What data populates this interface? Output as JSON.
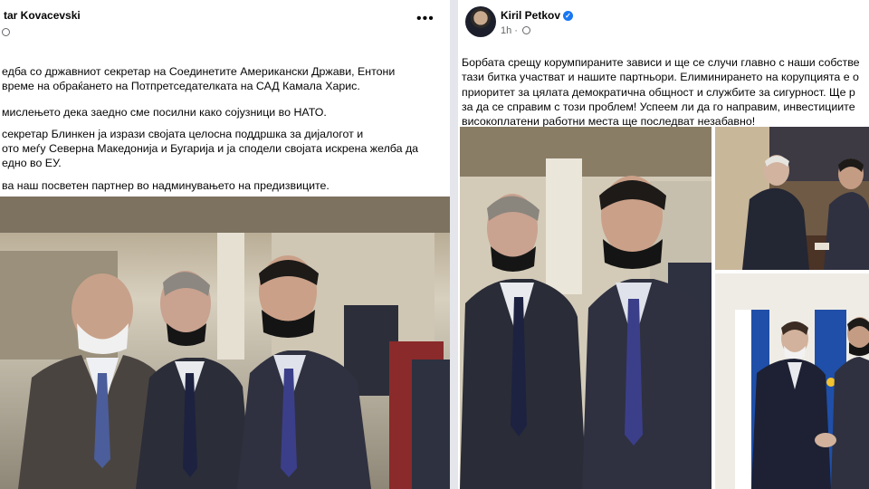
{
  "left_post": {
    "author": "tar Kovacevski",
    "lines": [
      "едба со државниот секретар на Соединетите Американски Држави, Ентони",
      "време на обраќането на Потпретседателката на САД Камала Харис.",
      "мислењето дека заедно сме посилни како сојузници во НАТО.",
      "секретар Блинкен ја изрази својата целосна поддршка за дијалогот и",
      "ото меѓу Северна Македонија и Бугарија и ја сподели својата искрена желба да",
      "едно во ЕУ.",
      "ва наш посветен партнер во надминувањето на предизвиците."
    ]
  },
  "right_post": {
    "author": "Kiril Petkov",
    "time": "1h",
    "lines": [
      "Борбата срещу корумпираните зависи и ще се случи главно с наши собстве",
      "тази битка участват и нашите партньори.  Елиминирането на корупцията е о",
      "приоритет за цялата демократична общност и службите за сигурност.  Ще р",
      "за да се справим с този проблем!  Успеем ли да го направим, инвестициите",
      "високоплатени работни места ще последват незабавно!"
    ]
  },
  "icons": {
    "more": "more-options-icon",
    "globe": "globe-icon",
    "verified": "verified-badge-icon"
  },
  "colors": {
    "text": "#050505",
    "secondary": "#65676b",
    "verified": "#1877f2",
    "divider": "#e4e6eb"
  }
}
